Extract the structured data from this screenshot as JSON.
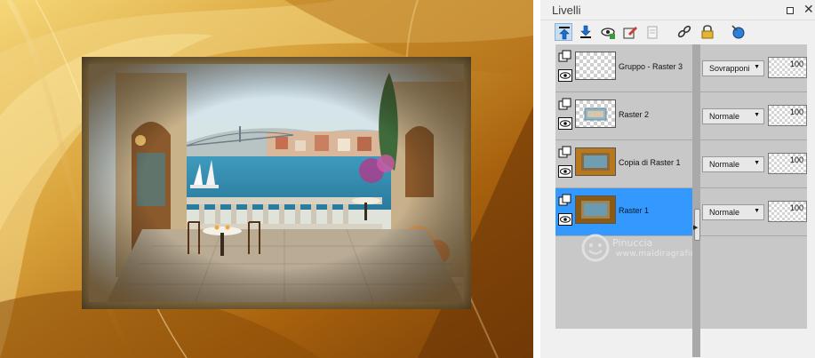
{
  "panel": {
    "title": "Livelli",
    "toolbar_icons": [
      "move-layer-up-icon",
      "move-layer-down-icon",
      "layer-visibility-icon",
      "edit-layer-icon",
      "new-layer-icon",
      "link-layers-icon",
      "lock-icon",
      "properties-icon"
    ]
  },
  "layers": [
    {
      "name": "Gruppo - Raster 3",
      "blend_mode": "Sovrapponi",
      "opacity": "100",
      "selected": false
    },
    {
      "name": "Raster 2",
      "blend_mode": "Normale",
      "opacity": "100",
      "selected": false
    },
    {
      "name": "Copia di Raster 1",
      "blend_mode": "Normale",
      "opacity": "100",
      "selected": false
    },
    {
      "name": "Raster 1",
      "blend_mode": "Normale",
      "opacity": "100",
      "selected": true
    }
  ],
  "watermark": {
    "name": "Pinuccia",
    "url": "www.maldiragrafica.eu"
  },
  "colors": {
    "selected_row": "#3399ff",
    "panel_bg": "#c8c8c8",
    "frame_gold": "#c88a1c"
  }
}
